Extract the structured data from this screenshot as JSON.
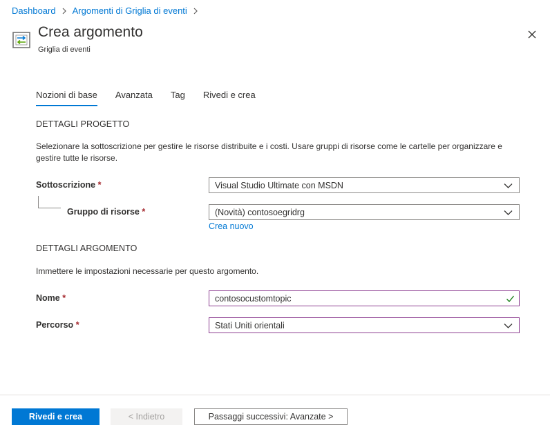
{
  "breadcrumb": {
    "items": [
      "Dashboard",
      "Argomenti di Griglia di eventi"
    ]
  },
  "header": {
    "title": "Crea argomento",
    "subtitle": "Griglia di eventi",
    "icon": "event-grid-topic-icon"
  },
  "tabs": [
    {
      "label": "Nozioni di base",
      "active": true
    },
    {
      "label": "Avanzata",
      "active": false
    },
    {
      "label": "Tag",
      "active": false
    },
    {
      "label": "Rivedi e crea",
      "active": false
    }
  ],
  "project": {
    "section_title": "DETTAGLI PROGETTO",
    "description": "Selezionare la sottoscrizione per gestire le risorse distribuite e i costi. Usare gruppi di risorse come le cartelle per organizzare e gestire tutte le risorse.",
    "subscription_label": "Sottoscrizione",
    "subscription_value": "Visual Studio Ultimate con MSDN",
    "resource_group_label": "Gruppo di risorse",
    "resource_group_value": "(Novità) contosoegridrg",
    "create_new": "Crea nuovo"
  },
  "topic": {
    "section_title": "DETTAGLI ARGOMENTO",
    "description": "Immettere le impostazioni necessarie per questo argomento.",
    "name_label": "Nome",
    "name_value": "contosocustomtopic",
    "location_label": "Percorso",
    "location_value": "Stati Uniti orientali"
  },
  "required_mark": "*",
  "footer": {
    "review_create": "Rivedi e crea",
    "back": "< Indietro",
    "next": "Passaggi successivi: Avanzate >"
  },
  "colors": {
    "accent": "#0078d4",
    "required": "#a4262c",
    "valid": "#107c10",
    "focus_border": "#8a3a8f"
  }
}
